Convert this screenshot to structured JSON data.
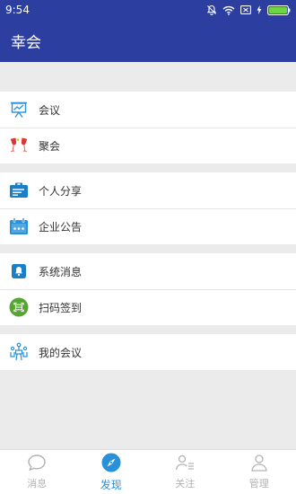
{
  "status_bar": {
    "time": "9:54",
    "icons": [
      "bell-off-icon",
      "wifi-icon",
      "sim-icon",
      "charging-icon",
      "battery-icon"
    ]
  },
  "app_bar": {
    "title": "幸会"
  },
  "menu": {
    "groups": [
      {
        "items": [
          {
            "label": "会议",
            "icon": "presentation-board-icon"
          },
          {
            "label": "聚会",
            "icon": "wine-glasses-icon"
          }
        ]
      },
      {
        "items": [
          {
            "label": "个人分享",
            "icon": "id-card-icon"
          },
          {
            "label": "企业公告",
            "icon": "calendar-icon"
          }
        ]
      },
      {
        "items": [
          {
            "label": "系统消息",
            "icon": "notification-bell-icon"
          },
          {
            "label": "扫码签到",
            "icon": "qr-scan-icon"
          }
        ]
      },
      {
        "items": [
          {
            "label": "我的会议",
            "icon": "meeting-people-icon"
          }
        ]
      }
    ]
  },
  "tab_bar": {
    "tabs": [
      {
        "label": "消息",
        "icon": "chat-bubble-icon",
        "active": false
      },
      {
        "label": "发现",
        "icon": "compass-icon",
        "active": true
      },
      {
        "label": "关注",
        "icon": "follow-list-icon",
        "active": false
      },
      {
        "label": "管理",
        "icon": "user-icon",
        "active": false
      }
    ]
  },
  "colors": {
    "header": "#2c3fa1",
    "accent": "#2a90d8",
    "inactive_tab": "#b3b3b3",
    "background": "#ebebeb"
  }
}
